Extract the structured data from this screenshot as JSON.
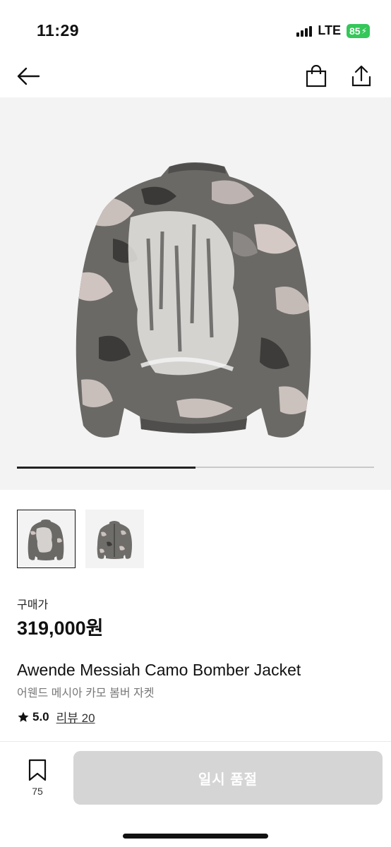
{
  "status_bar": {
    "time": "11:29",
    "network": "LTE",
    "battery": "85"
  },
  "nav": {
    "back_icon": "arrow-left-icon",
    "bag_icon": "shopping-bag-icon",
    "share_icon": "share-icon"
  },
  "gallery": {
    "progress": 0.5,
    "thumbnails": [
      {
        "name": "thumbnail-back",
        "selected": true
      },
      {
        "name": "thumbnail-front",
        "selected": false
      }
    ]
  },
  "product": {
    "price_label": "구매가",
    "price": "319,000원",
    "title_en": "Awende Messiah Camo Bomber Jacket",
    "title_ko": "어웬드 메시아 카모 봄버 자켓",
    "rating": "5.0",
    "review_label": "리뷰 20"
  },
  "bottom_bar": {
    "bookmark_count": "75",
    "action_label": "일시 품절"
  },
  "colors": {
    "accent": "#111111",
    "disabled": "#d5d5d5",
    "battery": "#34c759"
  }
}
